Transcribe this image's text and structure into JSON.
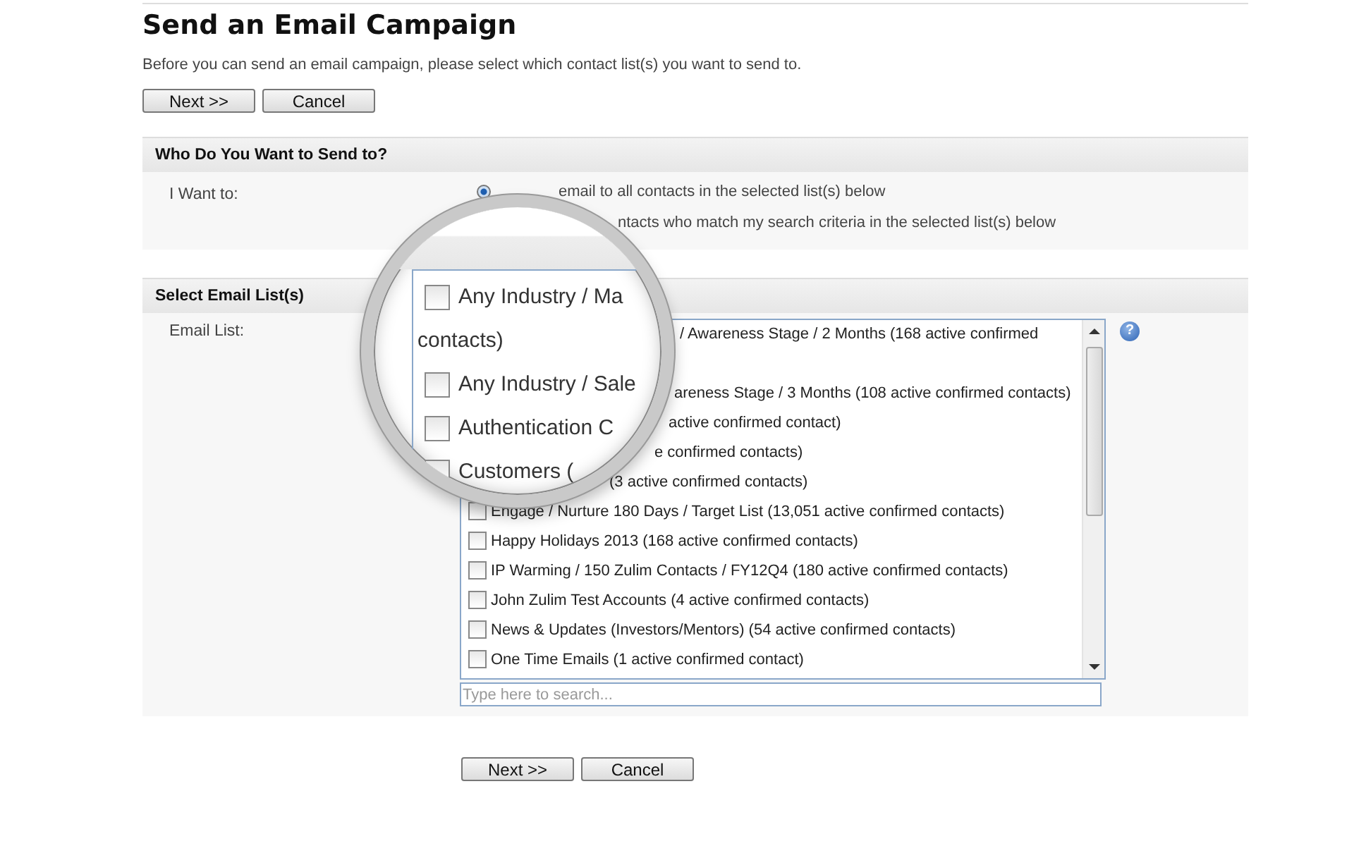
{
  "title": "Send an Email Campaign",
  "description": "Before you can send an email campaign, please select which contact list(s) you want to send to.",
  "top_buttons": [
    "Next >>",
    "Cancel"
  ],
  "send_to": {
    "heading": "Who Do You Want to Send to?",
    "label": "I Want to:",
    "options": [
      {
        "text": "email to all contacts in the selected list(s) below",
        "selected": true
      },
      {
        "text": "ntacts who match my search criteria in the selected list(s) below"
      }
    ]
  },
  "email_list": {
    "heading": "Select Email List(s)",
    "label": "Email List:",
    "help": "?",
    "items": [
      {
        "kind": "partial",
        "text": "/ Awareness Stage / 2 Months (168 active confirmed"
      },
      {
        "kind": "partial",
        "text": "areness Stage / 3 Months (108 active confirmed contacts)"
      },
      {
        "kind": "partial",
        "text": "active confirmed contact)"
      },
      {
        "kind": "partial",
        "text": "e confirmed contacts)"
      },
      {
        "kind": "partial",
        "text": "(3 active confirmed contacts)"
      },
      {
        "kind": "full",
        "text": "Engage / Nurture 180 Days / Target List (13,051 active confirmed contacts)",
        "checked": false
      },
      {
        "kind": "full",
        "text": "Happy Holidays 2013 (168 active confirmed contacts)",
        "checked": false
      },
      {
        "kind": "full",
        "text": "IP Warming / 150 Zulim Contacts / FY12Q4 (180 active confirmed contacts)",
        "checked": false
      },
      {
        "kind": "full",
        "text": "John Zulim Test Accounts (4 active confirmed contacts)",
        "checked": false
      },
      {
        "kind": "full",
        "text": "News & Updates (Investors/Mentors) (54 active confirmed contacts)",
        "checked": false
      },
      {
        "kind": "full",
        "text": "One Time Emails (1 active confirmed contact)",
        "checked": false
      }
    ],
    "search": {
      "placeholder": "Type here to search..."
    }
  },
  "magnifier": {
    "items": [
      {
        "text": "Any Industry / Ma",
        "checked": false
      },
      {
        "text": "contacts)"
      },
      {
        "text": "Any Industry / Sale",
        "checked": false
      },
      {
        "text": "Authentication C",
        "checked": false
      },
      {
        "text": "Customers (",
        "checked": false
      }
    ]
  },
  "bottom_buttons": [
    "Next >>",
    "Cancel"
  ]
}
